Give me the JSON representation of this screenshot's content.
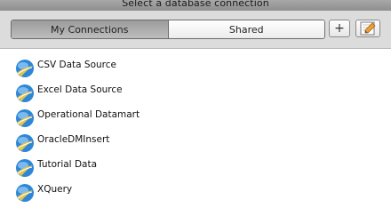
{
  "window": {
    "title": "Select a database connection"
  },
  "tabs": [
    {
      "label": "My Connections",
      "active": true
    },
    {
      "label": "Shared",
      "active": false
    }
  ],
  "toolbar": {
    "add_label": "+",
    "edit_icon": "edit-icon"
  },
  "connections": [
    {
      "label": "CSV Data Source",
      "icon": "database-connection-icon"
    },
    {
      "label": "Excel Data Source",
      "icon": "database-connection-icon"
    },
    {
      "label": "Operational Datamart",
      "icon": "database-connection-icon"
    },
    {
      "label": "OracleDMInsert",
      "icon": "database-connection-icon"
    },
    {
      "label": "Tutorial Data",
      "icon": "database-connection-icon"
    },
    {
      "label": "XQuery",
      "icon": "database-connection-icon"
    }
  ],
  "colors": {
    "globe": "#2e86d6",
    "swoosh": "#e6c34a",
    "titlebar": "#9a9a9a"
  }
}
